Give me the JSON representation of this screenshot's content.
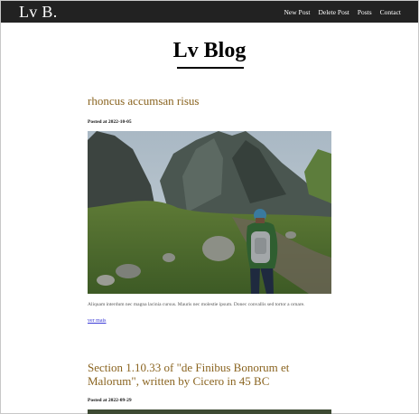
{
  "navbar": {
    "brand": "Lv B.",
    "links": [
      {
        "label": "New Post"
      },
      {
        "label": "Delete Post"
      },
      {
        "label": "Posts"
      },
      {
        "label": "Contact"
      }
    ]
  },
  "page": {
    "title": "Lv Blog"
  },
  "posts": [
    {
      "title": "rhoncus accumsan risus",
      "date": "Posted at 2022-10-05",
      "excerpt": "Aliquam interdum nec magna lacinia cursus. Mauris nec molestie ipsum. Donec convallis sed tortor a ornare.",
      "read_more": "ver mais"
    },
    {
      "title": "Section 1.10.33 of \"de Finibus Bonorum et Malorum\", written by Cicero in 45 BC",
      "date": "Posted at 2022-09-29"
    }
  ]
}
